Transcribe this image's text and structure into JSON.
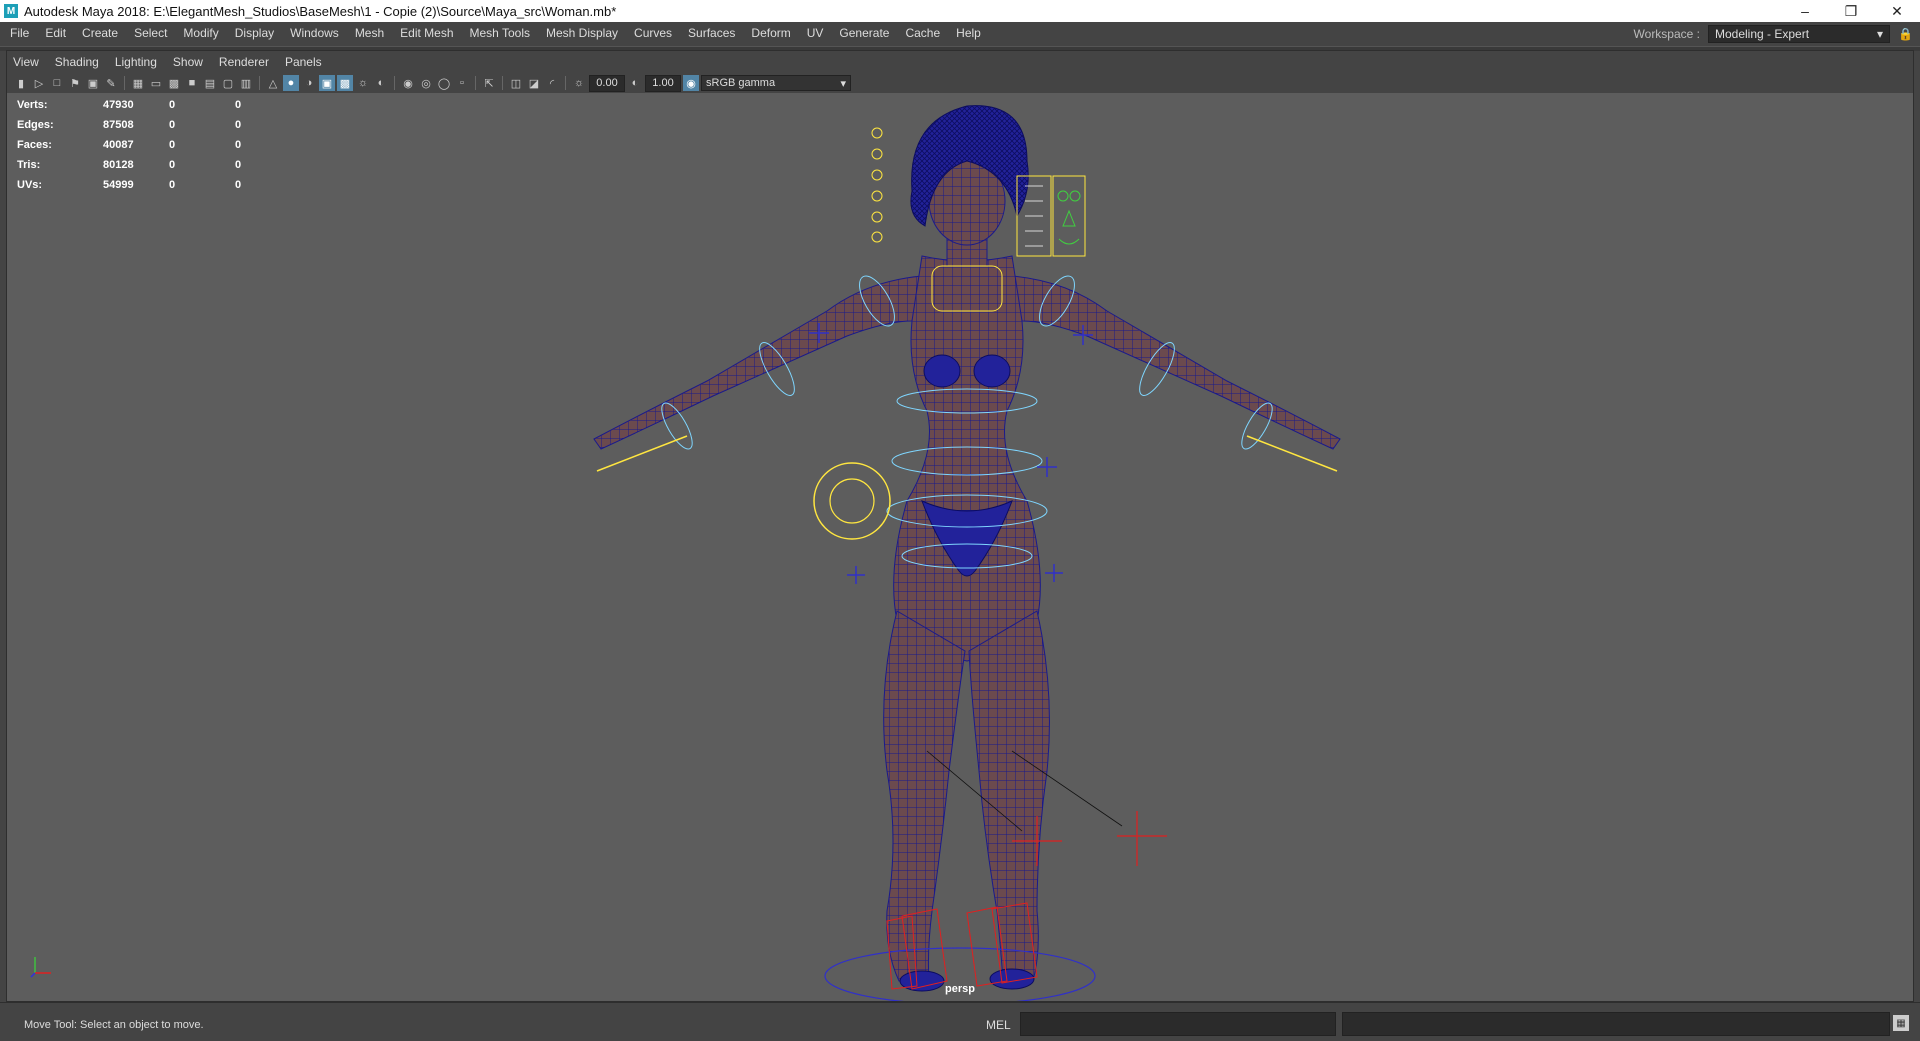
{
  "window": {
    "title": "Autodesk Maya 2018: E:\\ElegantMesh_Studios\\BaseMesh\\1 - Copie (2)\\Source\\Maya_src\\Woman.mb*",
    "app_icon": "M"
  },
  "menubar": {
    "items": [
      "File",
      "Edit",
      "Create",
      "Select",
      "Modify",
      "Display",
      "Windows",
      "Mesh",
      "Edit Mesh",
      "Mesh Tools",
      "Mesh Display",
      "Curves",
      "Surfaces",
      "Deform",
      "UV",
      "Generate",
      "Cache",
      "Help"
    ]
  },
  "workspace": {
    "label": "Workspace :",
    "value": "Modeling - Expert"
  },
  "panel_menu": {
    "items": [
      "View",
      "Shading",
      "Lighting",
      "Show",
      "Renderer",
      "Panels"
    ]
  },
  "toolbar": {
    "exposure": "0.00",
    "gamma": "1.00",
    "color_space": "sRGB gamma"
  },
  "hud": {
    "rows": [
      {
        "label": "Verts:",
        "v1": "47930",
        "v2": "0",
        "v3": "0"
      },
      {
        "label": "Edges:",
        "v1": "87508",
        "v2": "0",
        "v3": "0"
      },
      {
        "label": "Faces:",
        "v1": "40087",
        "v2": "0",
        "v3": "0"
      },
      {
        "label": "Tris:",
        "v1": "80128",
        "v2": "0",
        "v3": "0"
      },
      {
        "label": "UVs:",
        "v1": "54999",
        "v2": "0",
        "v3": "0"
      }
    ]
  },
  "viewport": {
    "camera_label": "persp"
  },
  "bottom": {
    "help_line": "Move Tool: Select an object to move.",
    "mel_label": "MEL"
  },
  "colors": {
    "viewport_bg": "#5d5d5d",
    "mesh_wire": "#1a1a8c",
    "mesh_fill": "#6b4a4e",
    "ctrl_cyan": "#7fd6ff",
    "ctrl_yellow": "#ffe640",
    "ctrl_red": "#e02020",
    "ctrl_blue": "#3030c8"
  }
}
